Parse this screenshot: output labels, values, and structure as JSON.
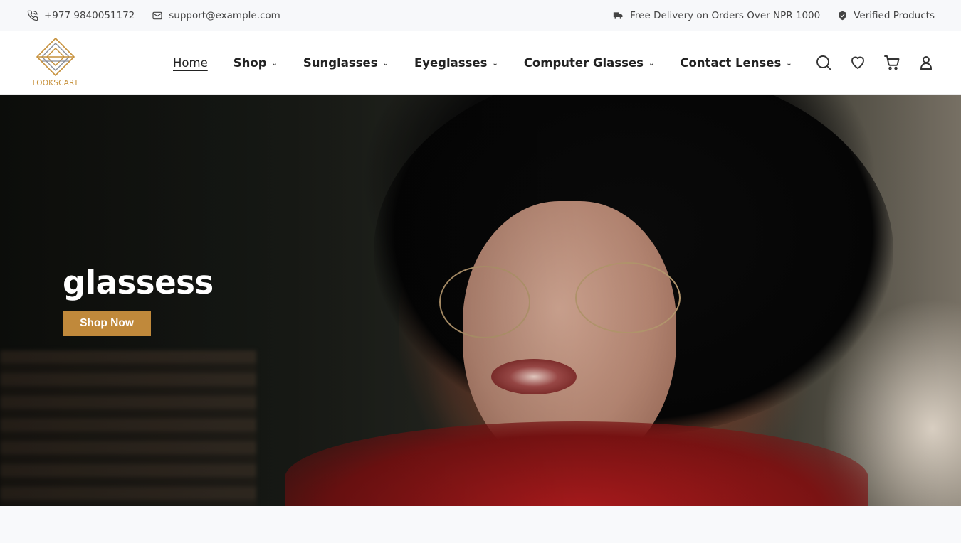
{
  "topbar": {
    "phone": "+977 9840051172",
    "email": "support@example.com",
    "delivery": "Free Delivery on Orders Over NPR 1000",
    "verified": "Verified Products"
  },
  "logo": {
    "text": "LOOKSCART",
    "accent": "#c6903a"
  },
  "nav": {
    "items": [
      {
        "label": "Home",
        "dropdown": false,
        "active": true
      },
      {
        "label": "Shop",
        "dropdown": true
      },
      {
        "label": "Sunglasses",
        "dropdown": true
      },
      {
        "label": "Eyeglasses",
        "dropdown": true
      },
      {
        "label": "Computer Glasses",
        "dropdown": true
      },
      {
        "label": "Contact Lenses",
        "dropdown": true
      }
    ]
  },
  "header_icons": [
    "search-icon",
    "heart-icon",
    "cart-icon",
    "user-icon"
  ],
  "hero": {
    "title": "glassess",
    "button": "Shop Now",
    "button_color": "#c0893b"
  }
}
